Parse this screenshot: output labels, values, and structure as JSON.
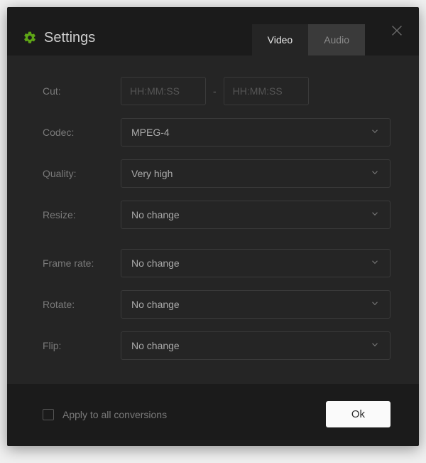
{
  "header": {
    "title": "Settings",
    "tabs": {
      "video": "Video",
      "audio": "Audio"
    }
  },
  "form": {
    "cut": {
      "label": "Cut:",
      "placeholder_from": "HH:MM:SS",
      "placeholder_to": "HH:MM:SS",
      "dash": "-"
    },
    "codec": {
      "label": "Codec:",
      "value": "MPEG-4"
    },
    "quality": {
      "label": "Quality:",
      "value": "Very high"
    },
    "resize": {
      "label": "Resize:",
      "value": "No change"
    },
    "frame_rate": {
      "label": "Frame rate:",
      "value": "No change"
    },
    "rotate": {
      "label": "Rotate:",
      "value": "No change"
    },
    "flip": {
      "label": "Flip:",
      "value": "No change"
    }
  },
  "footer": {
    "apply_all_label": "Apply to all conversions",
    "ok_label": "Ok"
  }
}
